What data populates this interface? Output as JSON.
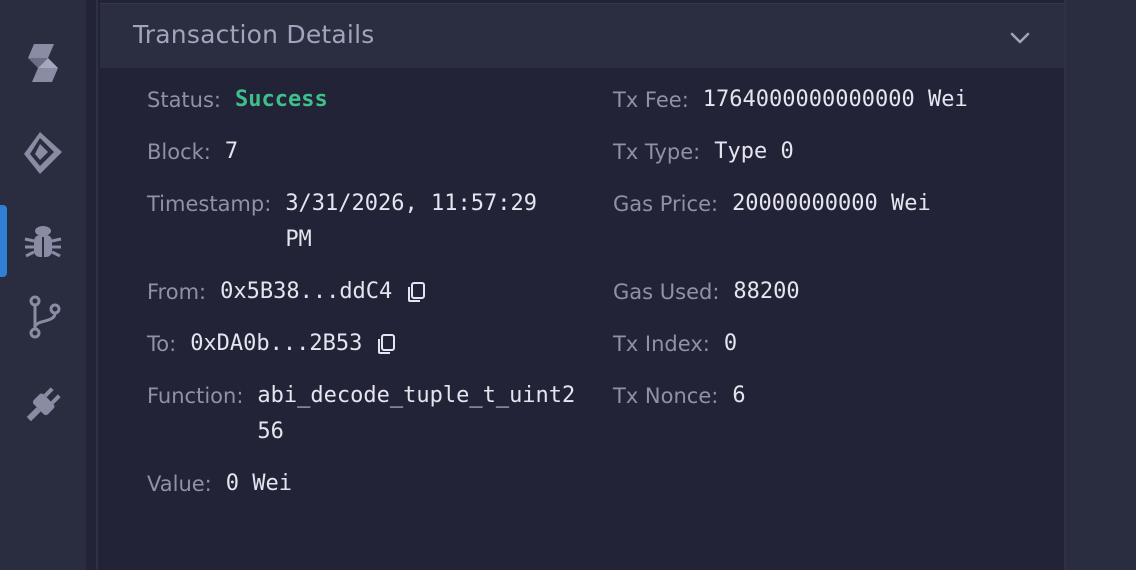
{
  "sidebar": {
    "icons": [
      "solidity-icon",
      "ethereum-icon",
      "bug-icon",
      "git-branch-icon",
      "plug-icon"
    ],
    "active_index": 2,
    "accent_color": "#2f7fd5"
  },
  "panel": {
    "title": "Transaction Details"
  },
  "details": {
    "status_label": "Status:",
    "status_value": "Success",
    "block_label": "Block:",
    "block_value": "7",
    "timestamp_label": "Timestamp:",
    "timestamp_value": "3/31/2026, 11:57:29 PM",
    "from_label": "From:",
    "from_value": "0x5B38...ddC4",
    "to_label": "To:",
    "to_value": "0xDA0b...2B53",
    "function_label": "Function:",
    "function_value": "abi_decode_tuple_t_uint256",
    "value_label": "Value:",
    "value_value": "0 Wei",
    "tx_fee_label": "Tx Fee:",
    "tx_fee_value": "1764000000000000 Wei",
    "tx_type_label": "Tx Type:",
    "tx_type_value": "Type 0",
    "gas_price_label": "Gas Price:",
    "gas_price_value": "20000000000 Wei",
    "gas_used_label": "Gas Used:",
    "gas_used_value": "88200",
    "tx_index_label": "Tx Index:",
    "tx_index_value": "0",
    "tx_nonce_label": "Tx Nonce:",
    "tx_nonce_value": "6"
  },
  "colors": {
    "success": "#3fbf8a",
    "background": "#222336",
    "header": "#2b2d40"
  }
}
